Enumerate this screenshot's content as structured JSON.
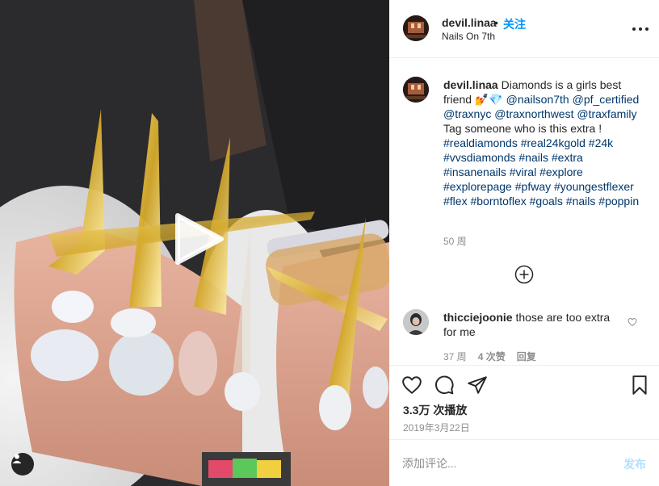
{
  "header": {
    "username": "devil.linaa",
    "separator": "•",
    "follow_label": "关注",
    "location": "Nails On 7th"
  },
  "caption": {
    "username": "devil.linaa",
    "text_1": "Diamonds is a girls best friend 💅💎",
    "mentions": [
      "@nailson7th",
      "@pf_certified",
      "@traxnyc",
      "@traxnorthwest",
      "@traxfamily"
    ],
    "text_2": "Tag someone who is this extra !",
    "hashtags": [
      "#realdiamonds",
      "#real24kgold",
      "#24k",
      "#vvsdiamonds",
      "#nails",
      "#extra",
      "#insanenails",
      "#viral",
      "#explore",
      "#explorepage",
      "#pfway",
      "#youngestflexer",
      "#flex",
      "#borntoflex",
      "#goals",
      "#nails",
      "#poppin"
    ],
    "time": "50 周"
  },
  "comment": {
    "username": "thicciejoonie",
    "text": "those are too extra for me",
    "time": "37 周",
    "likes": "4 次赞",
    "reply_label": "回复"
  },
  "actions": {
    "icons": [
      "heart-icon",
      "comment-icon",
      "share-icon",
      "bookmark-icon"
    ],
    "views": "3.3万 次播放",
    "date": "2019年3月22日"
  },
  "add_comment": {
    "placeholder": "添加评论...",
    "post_label": "发布"
  },
  "colors": {
    "link": "#00376b",
    "follow": "#0095f6",
    "post_disabled": "#b2dffc",
    "secondary_text": "#8e8e8e"
  }
}
